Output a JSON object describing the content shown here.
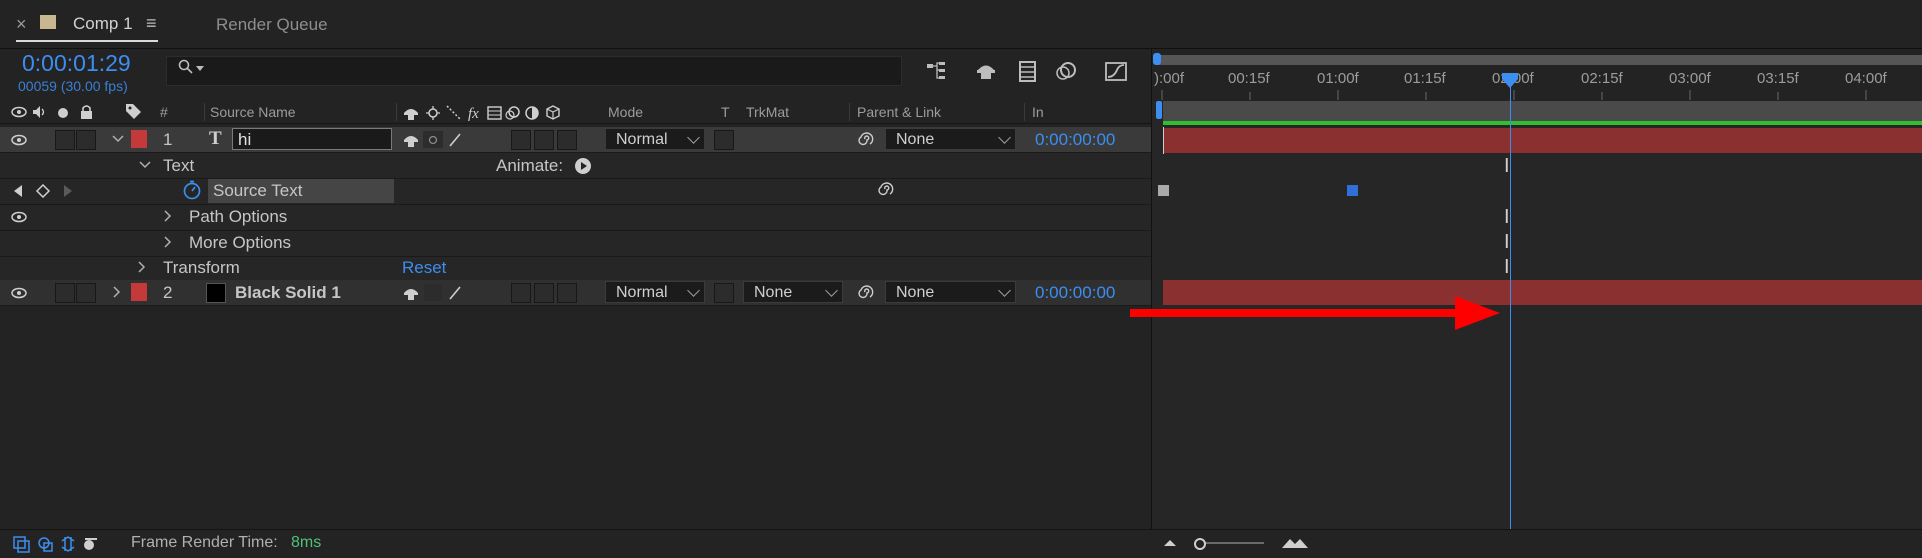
{
  "tabs": [
    {
      "label": "Comp 1",
      "active": true
    },
    {
      "label": "Render Queue",
      "active": false
    }
  ],
  "composition": {
    "current_time": "0:00:01:29",
    "frame_info": "00059 (30.00 fps)"
  },
  "columns": {
    "num": "#",
    "source_name": "Source Name",
    "mode": "Mode",
    "t": "T",
    "trkmat": "TrkMat",
    "parent": "Parent & Link",
    "in": "In"
  },
  "layers": [
    {
      "index": "1",
      "name": "hi",
      "mode": "Normal",
      "parent": "None",
      "in": "0:00:00:00",
      "label_color": "#c43a3a"
    },
    {
      "index": "2",
      "name": "Black Solid 1",
      "mode": "Normal",
      "trkmat": "None",
      "parent": "None",
      "in": "0:00:00:00",
      "label_color": "#c43a3a"
    }
  ],
  "properties": {
    "text_group": "Text",
    "animate_label": "Animate:",
    "source_text": "Source Text",
    "path_options": "Path Options",
    "more_options": "More Options",
    "transform": "Transform",
    "reset": "Reset"
  },
  "ruler_labels": [
    "):00f",
    "00:15f",
    "01:00f",
    "01:15f",
    "02:00f",
    "02:15f",
    "03:00f",
    "03:15f",
    "04:00f"
  ],
  "status": {
    "label": "Frame Render Time:",
    "value": "8ms"
  },
  "colors": {
    "accent_blue": "#3c8ef0",
    "label_red": "#c43a3a",
    "layer_bar": "#8b3030",
    "cache_green": "#2fbf2f",
    "annotation_arrow": "#ff0000"
  }
}
